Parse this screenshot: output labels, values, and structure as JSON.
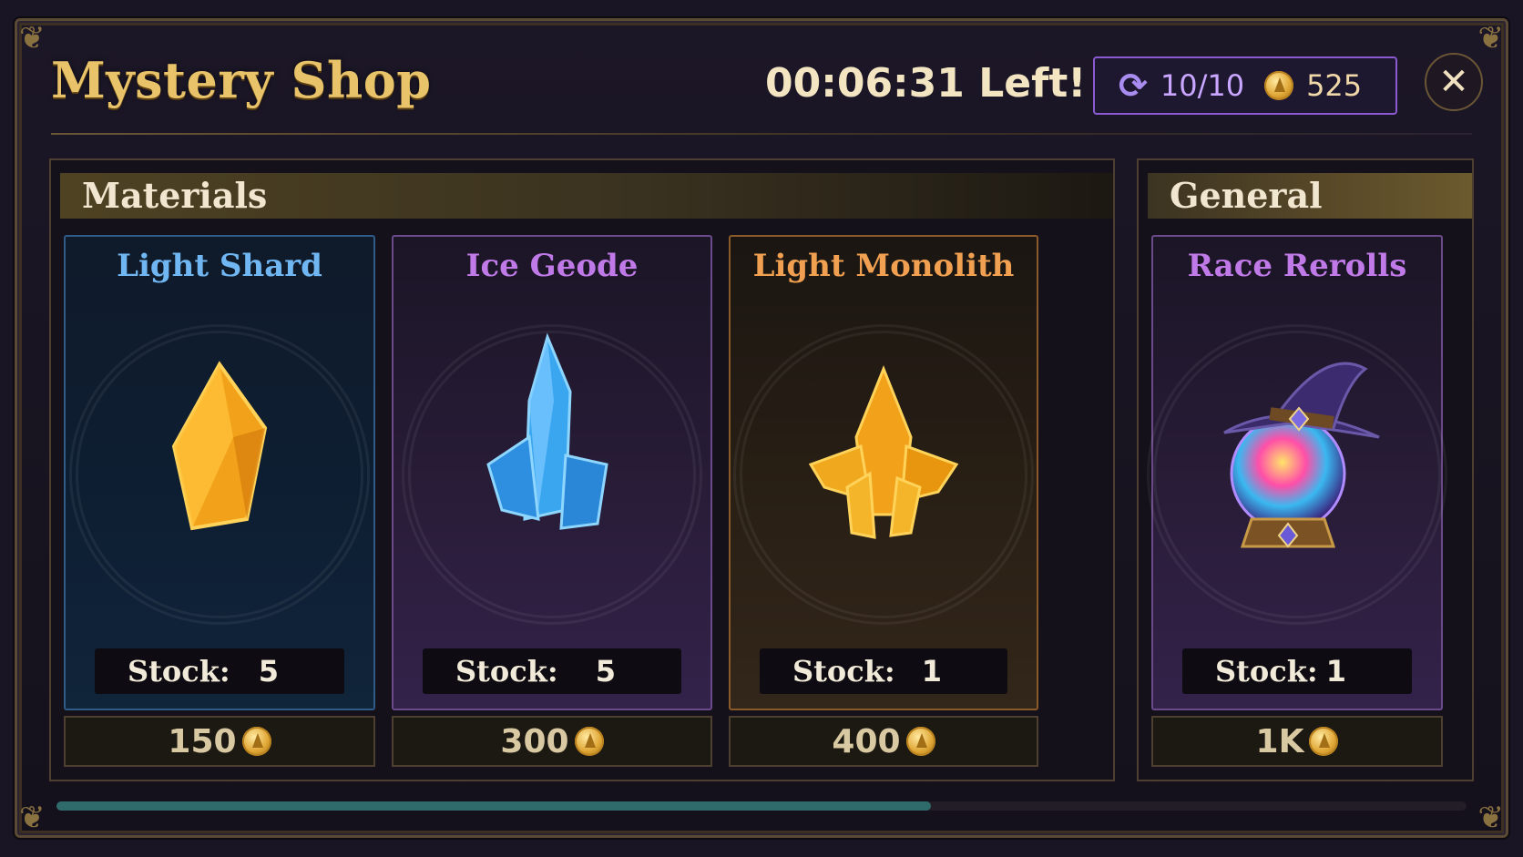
{
  "header": {
    "title": "Mystery Shop",
    "timer": "00:06:31 Left!",
    "rerolls": "10/10",
    "coins": "525",
    "close_label": "✕"
  },
  "sections": {
    "materials": {
      "title": "Materials"
    },
    "general": {
      "title": "General"
    }
  },
  "items": [
    {
      "name": "Light Shard",
      "stock_label": "Stock:",
      "stock": "5",
      "price": "150",
      "name_color": "#6fb6f2"
    },
    {
      "name": "Ice Geode",
      "stock_label": "Stock:",
      "stock": "5",
      "price": "300",
      "name_color": "#c07ae8"
    },
    {
      "name": "Light Monolith",
      "stock_label": "Stock:",
      "stock": "1",
      "price": "400",
      "name_color": "#f0a050"
    },
    {
      "name": "Race Rerolls",
      "stock_label": "Stock:",
      "stock": "1",
      "price": "1K",
      "name_color": "#c07ae8"
    }
  ],
  "scroll_progress": 0.62,
  "icons": [
    "refresh-icon",
    "coin-icon",
    "close-icon",
    "crystal-icon",
    "wizard-hat-icon",
    "crystal-ball-icon"
  ]
}
